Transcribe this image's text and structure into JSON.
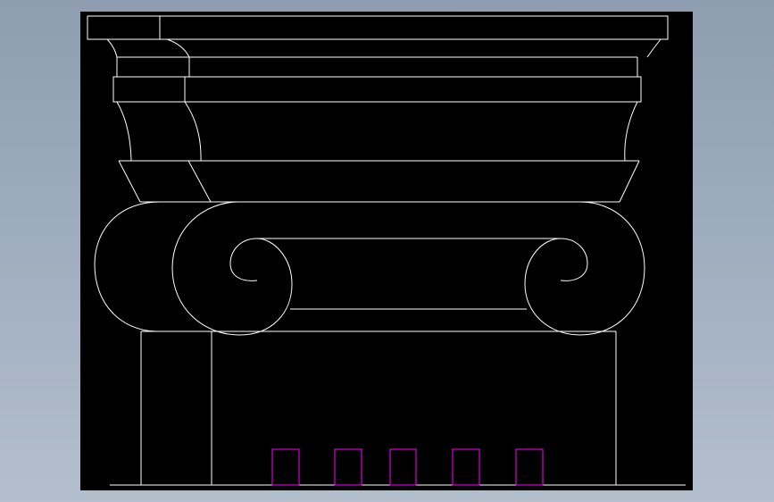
{
  "viewport": {
    "background": "#000000",
    "line_color": "#ffffff",
    "accent_line_color": "#ff00ff"
  },
  "drawing": {
    "subject": "ionic-column-capital",
    "modillion_blocks": 5
  }
}
